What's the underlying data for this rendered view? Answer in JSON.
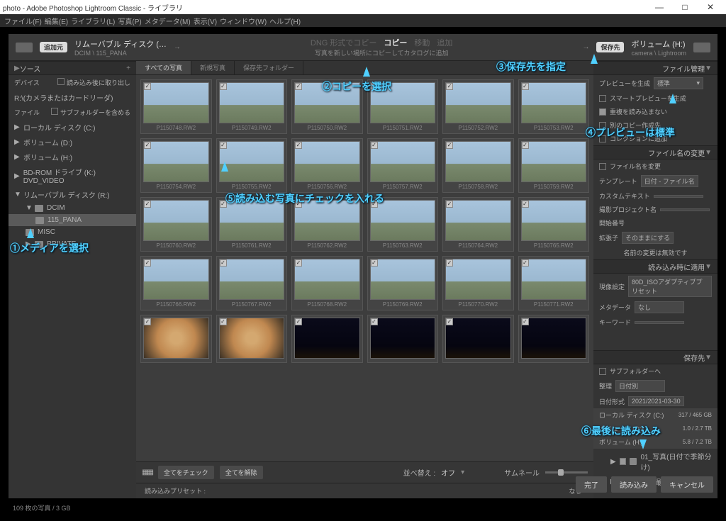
{
  "window": {
    "title": "photo - Adobe Photoshop Lightroom Classic - ライブラリ"
  },
  "menu": [
    "ファイル(F)",
    "編集(E)",
    "ライブラリ(L)",
    "写真(P)",
    "メタデータ(M)",
    "表示(V)",
    "ウィンドウ(W)",
    "ヘルプ(H)"
  ],
  "imp_top": {
    "src_badge": "追加元",
    "src_title": "リムーバブル ディスク (…",
    "src_path": "DCIM \\ 115_PANA",
    "dng": "DNG 形式でコピー",
    "copy": "コピー",
    "move": "移動",
    "add": "追加",
    "sub": "写真を新しい場所にコピーしてカタログに追加",
    "dest_badge": "保存先",
    "dest_title": "ボリューム (H:)",
    "dest_path": "camera \\ Lightroom"
  },
  "left": {
    "source": "ソース",
    "device": "デバイス",
    "eject": "読み込み後に取り出し",
    "reader": "R:\\(カメラまたはカードリーダ)",
    "file": "ファイル",
    "subfolders": "サブフォルダーを含める",
    "drives": [
      "ローカル ディスク (C:)",
      "ボリューム (D:)",
      "ボリューム (H:)",
      "BD-ROM ドライブ (K:) DVD_VIDEO",
      "リムーバブル ディスク (R:)"
    ],
    "tree": [
      "DCIM",
      "115_PANA",
      "MISC",
      "PRIVATE"
    ]
  },
  "tabs": {
    "all": "すべての写真",
    "new": "新規写真",
    "dest": "保存先フォルダー"
  },
  "thumbs": [
    {
      "f": "P1150748.RW2",
      "t": ""
    },
    {
      "f": "P1150749.RW2",
      "t": ""
    },
    {
      "f": "P1150750.RW2",
      "t": ""
    },
    {
      "f": "P1150751.RW2",
      "t": ""
    },
    {
      "f": "P1150752.RW2",
      "t": ""
    },
    {
      "f": "P1150753.RW2",
      "t": ""
    },
    {
      "f": "P1150754.RW2",
      "t": ""
    },
    {
      "f": "P1150755.RW2",
      "t": ""
    },
    {
      "f": "P1150756.RW2",
      "t": ""
    },
    {
      "f": "P1150757.RW2",
      "t": ""
    },
    {
      "f": "P1150758.RW2",
      "t": ""
    },
    {
      "f": "P1150759.RW2",
      "t": ""
    },
    {
      "f": "P1150760.RW2",
      "t": ""
    },
    {
      "f": "P1150761.RW2",
      "t": ""
    },
    {
      "f": "P1150762.RW2",
      "t": ""
    },
    {
      "f": "P1150763.RW2",
      "t": ""
    },
    {
      "f": "P1150764.RW2",
      "t": ""
    },
    {
      "f": "P1150765.RW2",
      "t": ""
    },
    {
      "f": "P1150766.RW2",
      "t": ""
    },
    {
      "f": "P1150767.RW2",
      "t": ""
    },
    {
      "f": "P1150768.RW2",
      "t": ""
    },
    {
      "f": "P1150769.RW2",
      "t": ""
    },
    {
      "f": "P1150770.RW2",
      "t": ""
    },
    {
      "f": "P1150771.RW2",
      "t": ""
    },
    {
      "f": "",
      "t": "food"
    },
    {
      "f": "",
      "t": "food"
    },
    {
      "f": "",
      "t": "dark"
    },
    {
      "f": "",
      "t": "dark"
    },
    {
      "f": "",
      "t": "dark"
    },
    {
      "f": "",
      "t": "dark"
    }
  ],
  "foot": {
    "check_all": "全てをチェック",
    "uncheck_all": "全てを解除",
    "sort": "並べ替え :",
    "sort_val": "オフ",
    "thumb": "サムネール"
  },
  "preset": {
    "label": "読み込みプリセット :",
    "val": "なし"
  },
  "right": {
    "file_mgmt": "ファイル管理",
    "build_prev": "プレビューを生成",
    "prev_val": "標準",
    "smart": "スマートプレビューを生成",
    "nodup": "重複を読み込まない",
    "second": "別のコピー作成先",
    "collection": "コレクションに追加",
    "rename": "ファイル名の変更",
    "rename_file": "ファイル名を変更",
    "template": "テンプレート",
    "template_val": "日付 - ファイル名",
    "custom": "カスタムテキスト",
    "proj": "撮影プロジェクト名",
    "start": "開始番号",
    "ext": "拡張子",
    "ext_val": "そのままにする",
    "warn": "名前の変更は無効です",
    "apply": "読み込み時に適用",
    "develop": "現像設定",
    "develop_val": "80D_ISOアダプティブプリセット",
    "meta": "メタデータ",
    "meta_val": "なし",
    "kw": "キーワード",
    "dest": "保存先",
    "subfolder": "サブフォルダーへ",
    "organize": "整理",
    "organize_val": "日付別",
    "datefmt": "日付形式",
    "datefmt_val": "2021/2021-03-30",
    "vol_c": "ローカル ディスク (C:)",
    "vol_c_sz": "317 / 465 GB",
    "vol_d": "ボリューム (D:)",
    "vol_d_sz": "1.0 / 2.7 TB",
    "vol_h": "ボリューム (H:)",
    "vol_h_sz": "5.8 / 7.2 TB",
    "folder1": "01_写真(日付で季節分け)",
    "folder2": "02_撮…"
  },
  "buttons": {
    "done": "完了",
    "import": "読み込み",
    "cancel": "キャンセル"
  },
  "status": "109 枚の写真 / 3 GB",
  "annot": {
    "a1": "①メディアを選択",
    "a2": "②コピーを選択",
    "a3": "③保存先を指定",
    "a4": "④プレビューは標準",
    "a5": "⑤読み込む写真にチェックを入れる",
    "a6": "⑥最後に読み込み"
  }
}
